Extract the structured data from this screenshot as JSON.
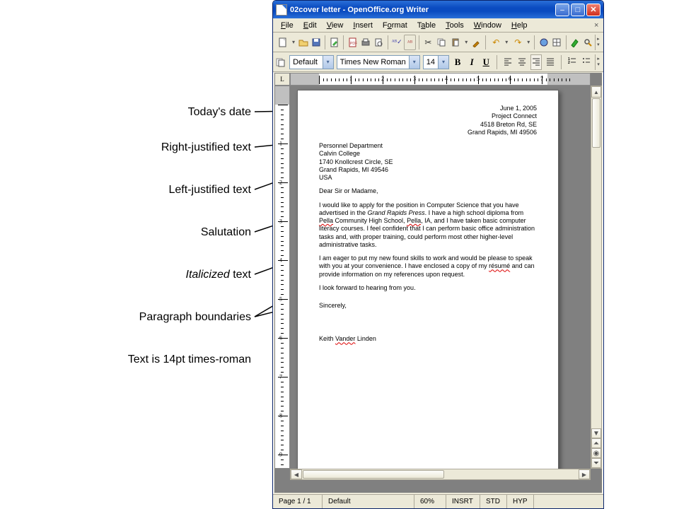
{
  "window": {
    "title": "02cover letter - OpenOffice.org Writer"
  },
  "menu": {
    "file": "File",
    "edit": "Edit",
    "view": "View",
    "insert": "Insert",
    "format": "Format",
    "table": "Table",
    "tools": "Tools",
    "window": "Window",
    "help": "Help"
  },
  "format": {
    "style": "Default",
    "font": "Times New Roman",
    "size": "14",
    "bold": "B",
    "italic": "I",
    "underline": "U"
  },
  "letter": {
    "date": "June 1, 2005",
    "sender_name": "Project Connect",
    "sender_addr1": "4518 Breton Rd, SE",
    "sender_addr2": "Grand Rapids, MI 49506",
    "recipient1": "Personnel Department",
    "recipient2": "Calvin College",
    "recipient3": "1740 Knollcrest Circle, SE",
    "recipient4": "Grand Rapids, MI 49546",
    "recipient5": "USA",
    "salutation": "Dear Sir or Madame,",
    "para1a": "I would like to apply for the position in Computer Science that you have advertised in the ",
    "para1_italic": "Grand Rapids Press",
    "para1b": ".  I have a high school diploma from ",
    "para1_sp1": "Pella",
    "para1c": " Community High School, ",
    "para1_sp2": "Pella",
    "para1d": ", IA, and I have taken basic computer literacy courses.   I feel confident that I can perform basic office administration tasks and, with proper training, could perform most other higher-level administrative tasks.",
    "para2a": "I am eager to put my new found skills to work and would be please to speak with you at your convenience.  I have enclosed a copy of my ",
    "para2_sp": "résumé",
    "para2b": " and can provide information on my references upon request.",
    "para3": "I look forward to hearing from you.",
    "closing": "Sincerely,",
    "sig1": "Keith ",
    "sig_sp": "Vander",
    "sig2": " Linden"
  },
  "status": {
    "page": "Page 1 / 1",
    "style": "Default",
    "zoom": "60%",
    "insrt": "INSRT",
    "std": "STD",
    "hyp": "HYP"
  },
  "annotations": {
    "a1": "Today's date",
    "a2": "Right-justified text",
    "a3": "Left-justified text",
    "a4": "Salutation",
    "a5_pre": "Italicized",
    "a5_post": " text",
    "a6": "Paragraph boundaries",
    "a7": "Text is 14pt times-roman"
  }
}
